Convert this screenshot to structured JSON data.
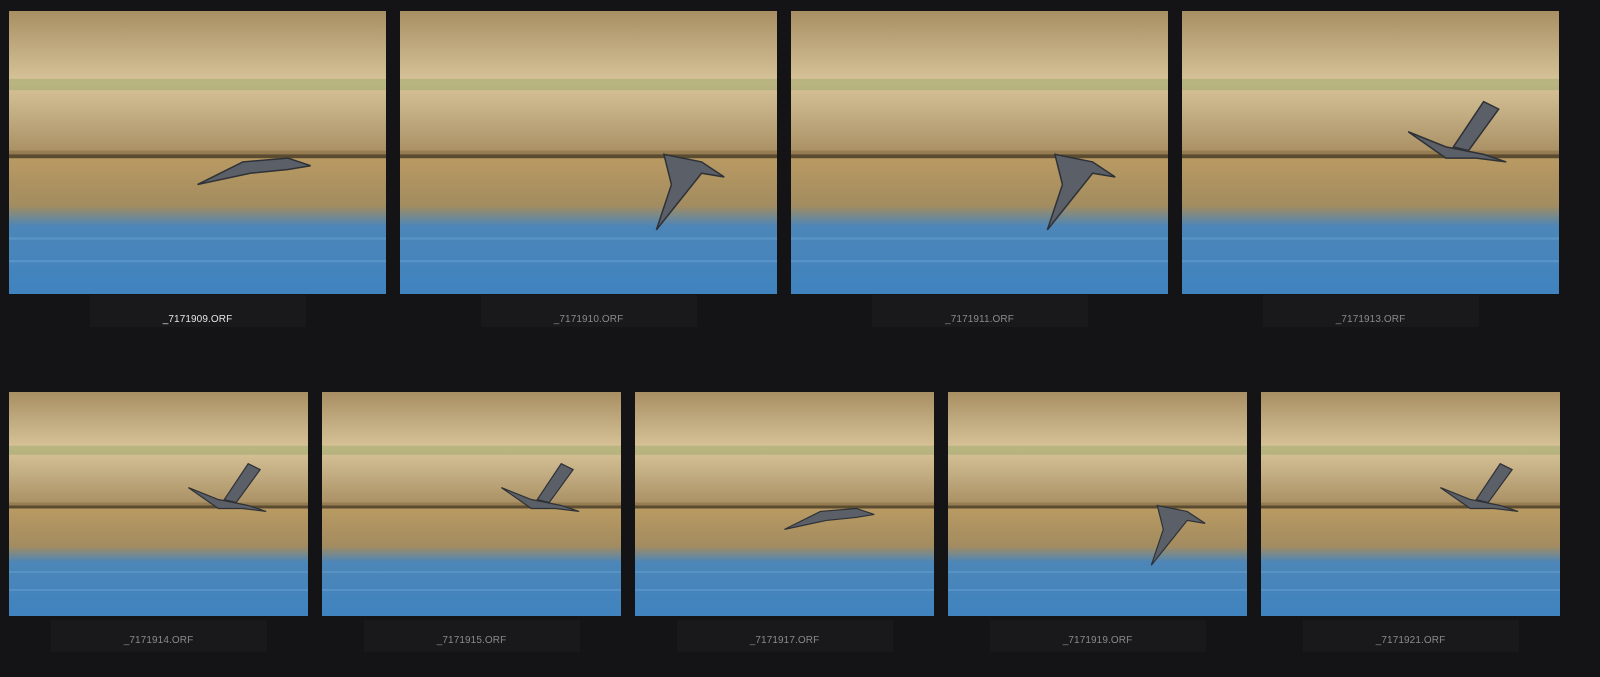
{
  "thumbnails": [
    {
      "filename": "_7171909.ORF",
      "selected": true,
      "bird": "glide-low",
      "bushes": []
    },
    {
      "filename": "_7171910.ORF",
      "selected": false,
      "bird": "wings-down",
      "bushes": []
    },
    {
      "filename": "_7171911.ORF",
      "selected": false,
      "bird": "wings-down",
      "bushes": []
    },
    {
      "filename": "_7171913.ORF",
      "selected": false,
      "bird": "wings-up",
      "bushes": []
    },
    {
      "filename": "_7171914.ORF",
      "selected": false,
      "bird": "wings-up",
      "bushes": []
    },
    {
      "filename": "_7171915.ORF",
      "selected": false,
      "bird": "wings-up",
      "bushes": []
    },
    {
      "filename": "_7171917.ORF",
      "selected": false,
      "bird": "glide-low",
      "bushes": []
    },
    {
      "filename": "_7171919.ORF",
      "selected": false,
      "bird": "wings-down",
      "bushes": []
    },
    {
      "filename": "_7171921.ORF",
      "selected": false,
      "bird": "wings-up",
      "bushes": []
    }
  ],
  "colors": {
    "background": "#141416",
    "caption_selected": "#e4e4e4",
    "caption_normal": "#8a8a8a",
    "bank_light": "#d8c49a",
    "bank_dark": "#a88f63",
    "grass": "#7f9a52",
    "water_gold": "#b99a62",
    "water_blue": "#3f83bf",
    "heron": "#5b6068"
  }
}
